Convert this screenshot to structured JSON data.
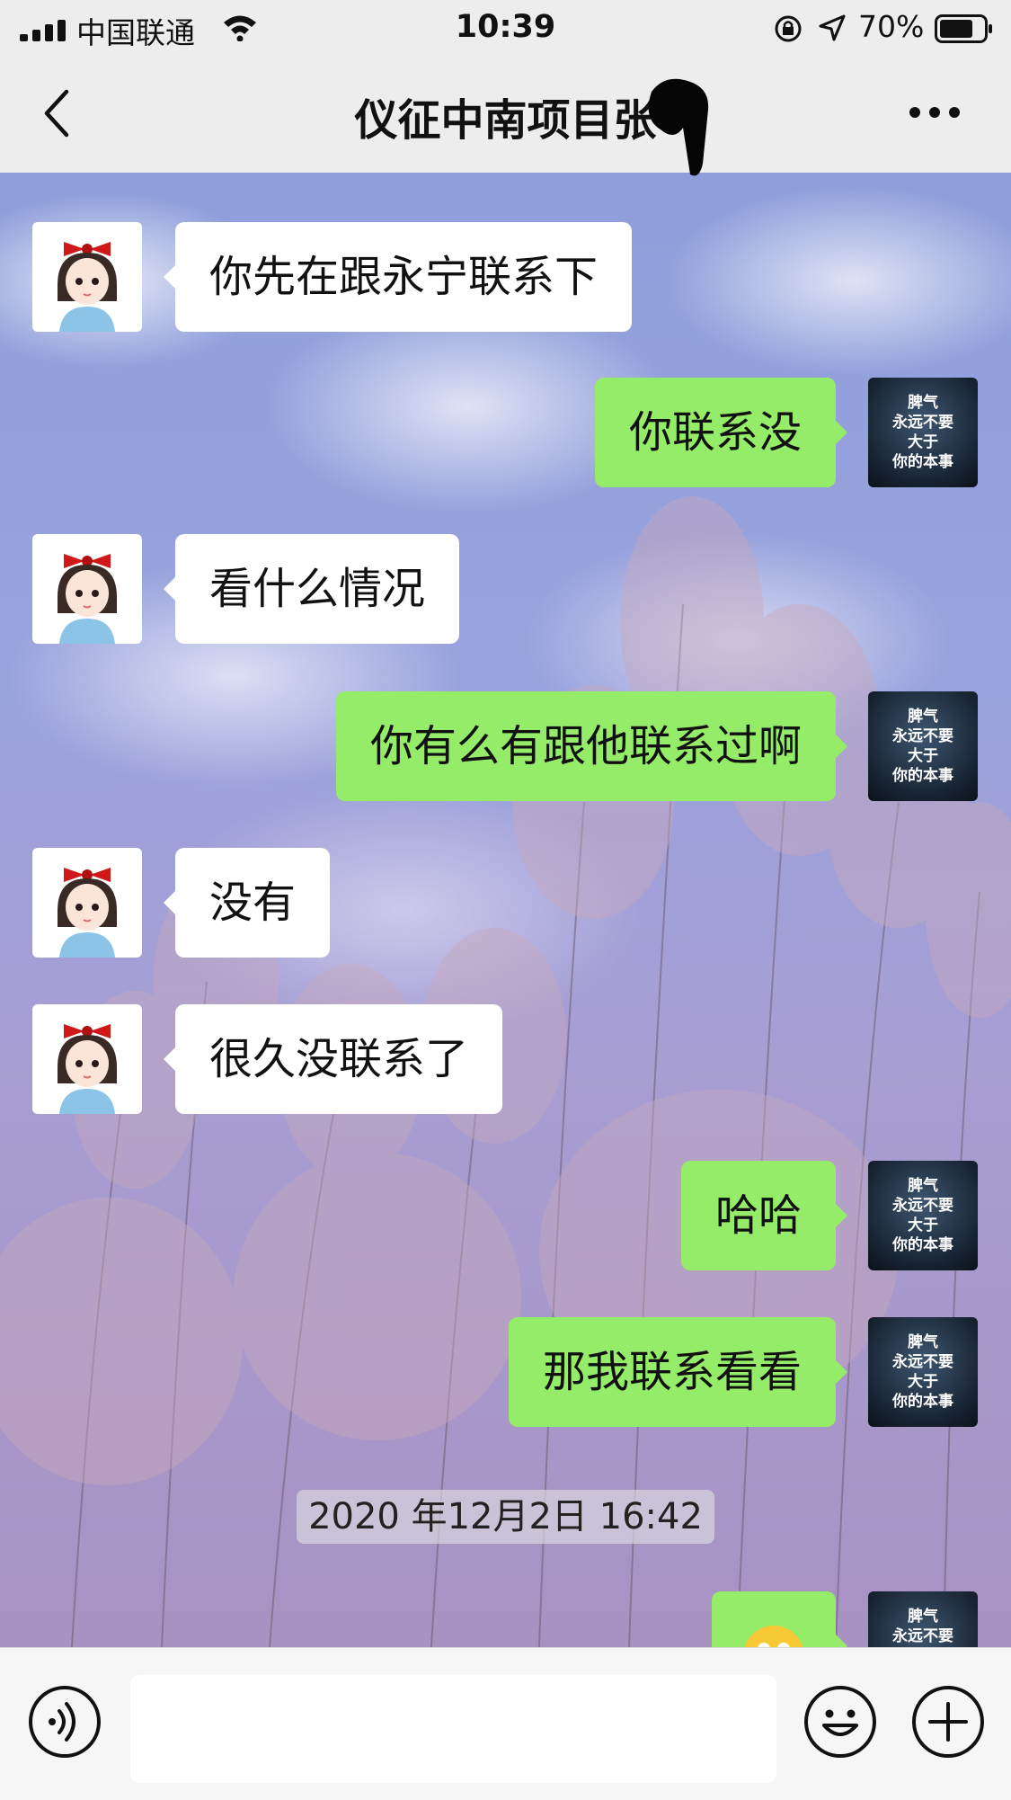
{
  "status_bar": {
    "carrier": "中国联通",
    "time": "10:39",
    "battery_percent": "70%"
  },
  "header": {
    "title": "仪征中南项目张"
  },
  "messages": [
    {
      "side": "in",
      "text": "你先在跟永宁联系下"
    },
    {
      "side": "out",
      "text": "你联系没"
    },
    {
      "side": "in",
      "text": "看什么情况"
    },
    {
      "side": "out",
      "text": "你有么有跟他联系过啊"
    },
    {
      "side": "in",
      "text": "没有"
    },
    {
      "side": "in",
      "text": "很久没联系了"
    },
    {
      "side": "out",
      "text": "哈哈"
    },
    {
      "side": "out",
      "text": "那我联系看看"
    }
  ],
  "timestamp": "2020 年12月2日 16:42",
  "self_avatar": {
    "line1": "脾气",
    "line2": "永远不要",
    "line3": "大于",
    "line4": "你的本事"
  },
  "colors": {
    "outgoing_bubble": "#95ec69",
    "incoming_bubble": "#ffffff",
    "bar_background": "#ededed"
  },
  "icons": {
    "back": "chevron-left-icon",
    "more": "more-dots-icon",
    "voice": "voice-icon",
    "emoji": "emoji-icon",
    "plus": "plus-icon"
  }
}
